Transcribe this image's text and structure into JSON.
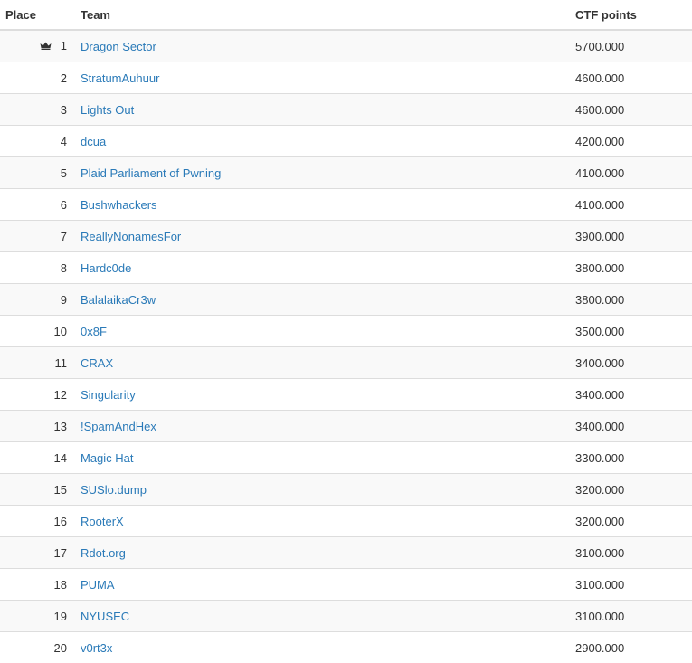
{
  "header": {
    "place": "Place",
    "team": "Team",
    "points": "CTF points"
  },
  "icons": {
    "leader": "crown-icon"
  },
  "colors": {
    "link": "#2a7ab8",
    "row_stripe": "#f9f9f9",
    "border": "#dddddd"
  },
  "rows": [
    {
      "place": "1",
      "team": "Dragon Sector",
      "points": "5700.000",
      "leader": true
    },
    {
      "place": "2",
      "team": "StratumAuhuur",
      "points": "4600.000"
    },
    {
      "place": "3",
      "team": "Lights Out",
      "points": "4600.000"
    },
    {
      "place": "4",
      "team": "dcua",
      "points": "4200.000"
    },
    {
      "place": "5",
      "team": "Plaid Parliament of Pwning",
      "points": "4100.000"
    },
    {
      "place": "6",
      "team": "Bushwhackers",
      "points": "4100.000"
    },
    {
      "place": "7",
      "team": "ReallyNonamesFor",
      "points": "3900.000"
    },
    {
      "place": "8",
      "team": "Hardc0de",
      "points": "3800.000"
    },
    {
      "place": "9",
      "team": "BalalaikaCr3w",
      "points": "3800.000"
    },
    {
      "place": "10",
      "team": "0x8F",
      "points": "3500.000"
    },
    {
      "place": "11",
      "team": "CRAX",
      "points": "3400.000"
    },
    {
      "place": "12",
      "team": "Singularity",
      "points": "3400.000"
    },
    {
      "place": "13",
      "team": "!SpamAndHex",
      "points": "3400.000"
    },
    {
      "place": "14",
      "team": "Magic Hat",
      "points": "3300.000"
    },
    {
      "place": "15",
      "team": "SUSlo.dump",
      "points": "3200.000"
    },
    {
      "place": "16",
      "team": "RooterX",
      "points": "3200.000"
    },
    {
      "place": "17",
      "team": "Rdot.org",
      "points": "3100.000"
    },
    {
      "place": "18",
      "team": "PUMA",
      "points": "3100.000"
    },
    {
      "place": "19",
      "team": "NYUSEC",
      "points": "3100.000"
    },
    {
      "place": "20",
      "team": "v0rt3x",
      "points": "2900.000"
    }
  ]
}
